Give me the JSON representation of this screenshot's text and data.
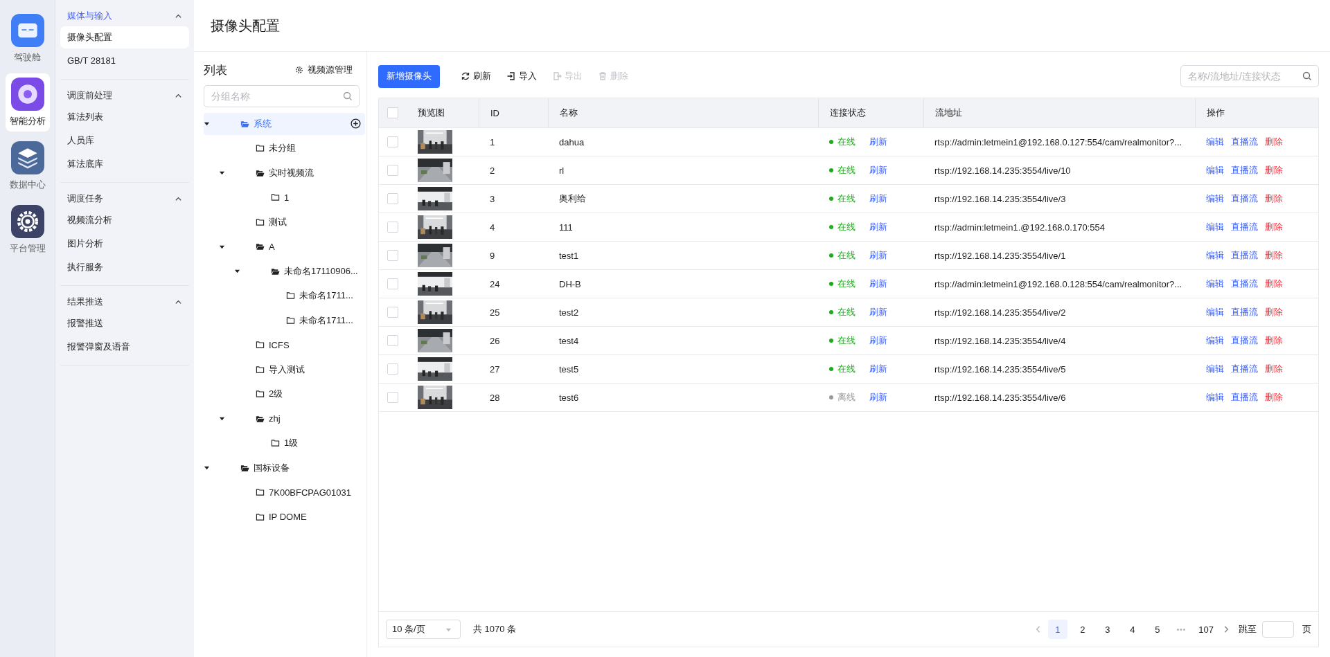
{
  "rail": [
    {
      "label": "驾驶舱",
      "selected": false
    },
    {
      "label": "智能分析",
      "selected": true
    },
    {
      "label": "数据中心",
      "selected": false
    },
    {
      "label": "平台管理",
      "selected": false
    }
  ],
  "submenu": [
    {
      "title": "媒体与输入",
      "expanded": true,
      "items": [
        {
          "label": "摄像头配置",
          "selected": true
        },
        {
          "label": "GB/T 28181",
          "selected": false
        }
      ]
    },
    {
      "title": "调度前处理",
      "expanded": true,
      "items": [
        {
          "label": "算法列表",
          "selected": false
        },
        {
          "label": "人员库",
          "selected": false
        },
        {
          "label": "算法底库",
          "selected": false
        }
      ]
    },
    {
      "title": "调度任务",
      "expanded": true,
      "items": [
        {
          "label": "视频流分析",
          "selected": false
        },
        {
          "label": "图片分析",
          "selected": false
        },
        {
          "label": "执行服务",
          "selected": false
        }
      ]
    },
    {
      "title": "结果推送",
      "expanded": true,
      "items": [
        {
          "label": "报警推送",
          "selected": false
        },
        {
          "label": "报警弹窗及语音",
          "selected": false
        }
      ]
    }
  ],
  "page_title": "摄像头配置",
  "tree_panel": {
    "title": "列表",
    "manage_button": "视频源管理",
    "search": {
      "placeholder": "分组名称"
    },
    "tree": [
      {
        "label": "系统",
        "selected": true,
        "expanded": true,
        "children": [
          {
            "label": "未分组",
            "selected": false
          },
          {
            "label": "实时视频流",
            "selected": false,
            "expanded": true,
            "children": [
              {
                "label": "1",
                "selected": false
              }
            ]
          },
          {
            "label": "测试",
            "selected": false
          },
          {
            "label": "A",
            "selected": false,
            "expanded": true,
            "children": [
              {
                "label": "未命名17110906...",
                "selected": false,
                "expanded": true,
                "children": [
                  {
                    "label": "未命名1711...",
                    "selected": false
                  },
                  {
                    "label": "未命名1711...",
                    "selected": false
                  }
                ]
              }
            ]
          },
          {
            "label": "ICFS",
            "selected": false
          },
          {
            "label": "导入测试",
            "selected": false
          },
          {
            "label": "2级",
            "selected": false
          },
          {
            "label": "zhj",
            "selected": false,
            "expanded": true,
            "children": [
              {
                "label": "1级",
                "selected": false
              }
            ]
          }
        ]
      },
      {
        "label": "国标设备",
        "selected": false,
        "expanded": true,
        "children": [
          {
            "label": "7K00BFCPAG01031",
            "selected": false
          },
          {
            "label": "IP DOME",
            "selected": false
          }
        ]
      }
    ]
  },
  "toolbar": {
    "primary": "新增摄像头",
    "actions": [
      {
        "label": "刷新",
        "disabled": false
      },
      {
        "label": "导入",
        "disabled": false
      },
      {
        "label": "导出",
        "disabled": true
      },
      {
        "label": "删除",
        "disabled": true
      }
    ],
    "search": {
      "placeholder": "名称/流地址/连接状态"
    }
  },
  "table": {
    "select_all_checked": false,
    "columns": [
      "预览图",
      "ID",
      "名称",
      "连接状态",
      "流地址",
      "操作"
    ],
    "rows": [
      {
        "checked": false,
        "preview": {
          "kind": "picture"
        },
        "id": "1",
        "name": "dahua",
        "status": {
          "text": "在线",
          "kind": "online"
        },
        "refresh": "刷新",
        "url": "rtsp://admin:letmein1@192.168.0.127:554/cam/realmonitor?...",
        "actions": [
          {
            "label": "编辑",
            "kind": "normal"
          },
          {
            "label": "直播流",
            "kind": "normal"
          },
          {
            "label": "删除",
            "kind": "danger"
          }
        ]
      },
      {
        "checked": false,
        "preview": {
          "kind": "picture"
        },
        "id": "2",
        "name": "rl",
        "status": {
          "text": "在线",
          "kind": "online"
        },
        "refresh": "刷新",
        "url": "rtsp://192.168.14.235:3554/live/10",
        "actions": [
          {
            "label": "编辑",
            "kind": "normal"
          },
          {
            "label": "直播流",
            "kind": "normal"
          },
          {
            "label": "删除",
            "kind": "danger"
          }
        ]
      },
      {
        "checked": false,
        "preview": {
          "kind": "picture"
        },
        "id": "3",
        "name": "奥利给",
        "status": {
          "text": "在线",
          "kind": "online"
        },
        "refresh": "刷新",
        "url": "rtsp://192.168.14.235:3554/live/3",
        "actions": [
          {
            "label": "编辑",
            "kind": "normal"
          },
          {
            "label": "直播流",
            "kind": "normal"
          },
          {
            "label": "删除",
            "kind": "danger"
          }
        ]
      },
      {
        "checked": false,
        "preview": {
          "kind": "picture"
        },
        "id": "4",
        "name": "111",
        "status": {
          "text": "在线",
          "kind": "online"
        },
        "refresh": "刷新",
        "url": "rtsp://admin:letmein1.@192.168.0.170:554",
        "actions": [
          {
            "label": "编辑",
            "kind": "normal"
          },
          {
            "label": "直播流",
            "kind": "normal"
          },
          {
            "label": "删除",
            "kind": "danger"
          }
        ]
      },
      {
        "checked": false,
        "preview": {
          "kind": "picture"
        },
        "id": "9",
        "name": "test1",
        "status": {
          "text": "在线",
          "kind": "online"
        },
        "refresh": "刷新",
        "url": "rtsp://192.168.14.235:3554/live/1",
        "actions": [
          {
            "label": "编辑",
            "kind": "normal"
          },
          {
            "label": "直播流",
            "kind": "normal"
          },
          {
            "label": "删除",
            "kind": "danger"
          }
        ]
      },
      {
        "checked": false,
        "preview": {
          "kind": "picture"
        },
        "id": "24",
        "name": "DH-B",
        "status": {
          "text": "在线",
          "kind": "online"
        },
        "refresh": "刷新",
        "url": "rtsp://admin:letmein1@192.168.0.128:554/cam/realmonitor?...",
        "actions": [
          {
            "label": "编辑",
            "kind": "normal"
          },
          {
            "label": "直播流",
            "kind": "normal"
          },
          {
            "label": "删除",
            "kind": "danger"
          }
        ]
      },
      {
        "checked": false,
        "preview": {
          "kind": "picture"
        },
        "id": "25",
        "name": "test2",
        "status": {
          "text": "在线",
          "kind": "online"
        },
        "refresh": "刷新",
        "url": "rtsp://192.168.14.235:3554/live/2",
        "actions": [
          {
            "label": "编辑",
            "kind": "normal"
          },
          {
            "label": "直播流",
            "kind": "normal"
          },
          {
            "label": "删除",
            "kind": "danger"
          }
        ]
      },
      {
        "checked": false,
        "preview": {
          "kind": "picture"
        },
        "id": "26",
        "name": "test4",
        "status": {
          "text": "在线",
          "kind": "online"
        },
        "refresh": "刷新",
        "url": "rtsp://192.168.14.235:3554/live/4",
        "actions": [
          {
            "label": "编辑",
            "kind": "normal"
          },
          {
            "label": "直播流",
            "kind": "normal"
          },
          {
            "label": "删除",
            "kind": "danger"
          }
        ]
      },
      {
        "checked": false,
        "preview": {
          "kind": "picture"
        },
        "id": "27",
        "name": "test5",
        "status": {
          "text": "在线",
          "kind": "online"
        },
        "refresh": "刷新",
        "url": "rtsp://192.168.14.235:3554/live/5",
        "actions": [
          {
            "label": "编辑",
            "kind": "normal"
          },
          {
            "label": "直播流",
            "kind": "normal"
          },
          {
            "label": "删除",
            "kind": "danger"
          }
        ]
      },
      {
        "checked": false,
        "preview": {
          "kind": "picture"
        },
        "id": "28",
        "name": "test6",
        "status": {
          "text": "离线",
          "kind": "offline"
        },
        "refresh": "刷新",
        "url": "rtsp://192.168.14.235:3554/live/6",
        "actions": [
          {
            "label": "编辑",
            "kind": "normal"
          },
          {
            "label": "直播流",
            "kind": "normal"
          },
          {
            "label": "删除",
            "kind": "danger"
          }
        ]
      }
    ]
  },
  "pagination": {
    "page_size": "10 条/页",
    "total": "共 1070 条",
    "pages": [
      {
        "label": "1",
        "kind": "page",
        "selected": true
      },
      {
        "label": "2",
        "kind": "page",
        "selected": false
      },
      {
        "label": "3",
        "kind": "page",
        "selected": false
      },
      {
        "label": "4",
        "kind": "page",
        "selected": false
      },
      {
        "label": "5",
        "kind": "page",
        "selected": false
      },
      {
        "label": "•••",
        "kind": "more"
      },
      {
        "label": "107",
        "kind": "page",
        "selected": false
      }
    ],
    "jump_label": "跳至",
    "jump_suffix": "页"
  }
}
